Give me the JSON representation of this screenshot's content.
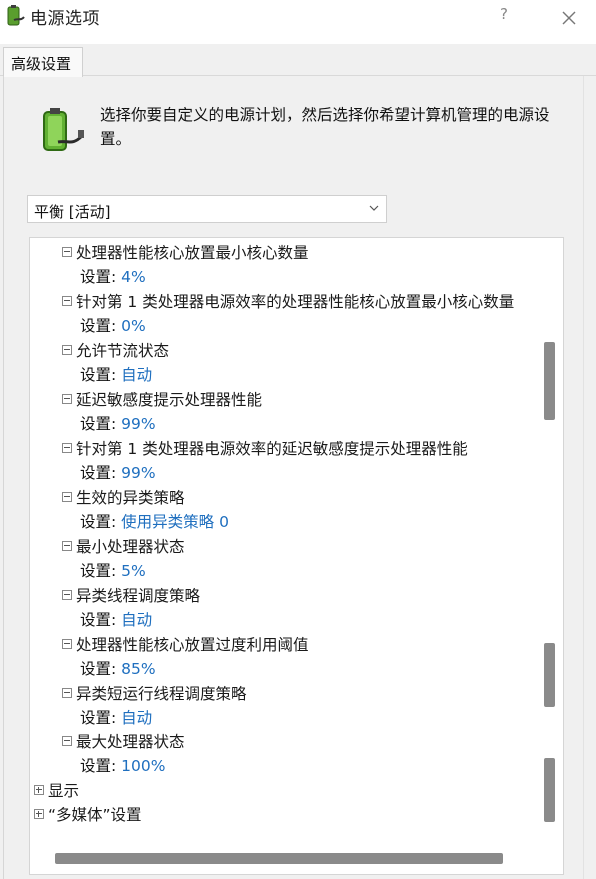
{
  "window": {
    "title": "电源选项",
    "help_label": "?"
  },
  "tabs": [
    {
      "label": "高级设置"
    }
  ],
  "description": "选择你要自定义的电源计划，然后选择你希望计算机管理的电源设置。",
  "plan_select": {
    "value": "平衡 [活动]"
  },
  "setting_prefix": "设置:",
  "settings": [
    {
      "name": "处理器性能核心放置最小核心数量",
      "value": "4%"
    },
    {
      "name": "针对第 1 类处理器电源效率的处理器性能核心放置最小核心数量",
      "value": "0%"
    },
    {
      "name": "允许节流状态",
      "value": "自动"
    },
    {
      "name": "延迟敏感度提示处理器性能",
      "value": "99%"
    },
    {
      "name": "针对第 1 类处理器电源效率的延迟敏感度提示处理器性能",
      "value": "99%"
    },
    {
      "name": "生效的异类策略",
      "value": "使用异类策略 0"
    },
    {
      "name": "最小处理器状态",
      "value": "5%"
    },
    {
      "name": "异类线程调度策略",
      "value": "自动"
    },
    {
      "name": "处理器性能核心放置过度利用阈值",
      "value": "85%"
    },
    {
      "name": "异类短运行线程调度策略",
      "value": "自动"
    },
    {
      "name": "最大处理器状态",
      "value": "100%"
    }
  ],
  "top_items": [
    {
      "label": "显示"
    },
    {
      "label": "“多媒体”设置"
    }
  ],
  "icons": {
    "app": "battery-plug-icon",
    "description": "battery-plug-icon",
    "collapse": "minus-box-icon",
    "expand": "plus-box-icon"
  },
  "colors": {
    "value_text": "#1f6fbf",
    "panel_bg": "#f0f0f0",
    "scrollbar": "#8a8a8a"
  }
}
